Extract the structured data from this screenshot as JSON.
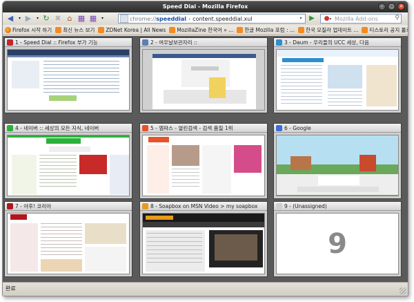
{
  "window": {
    "title": "Speed Dial - Mozilla Firefox"
  },
  "nav": {
    "url_scheme": "chrome://",
    "url_host": "speeddial",
    "url_separator": "›",
    "url_path": "content.speeddial.xul",
    "search_placeholder": "Mozilla Add-ons"
  },
  "bookmarks": [
    {
      "label": "Firefox 시작 하기",
      "icon": "firefox-icon"
    },
    {
      "label": "최신 뉴스 보기",
      "icon": "rss-icon"
    },
    {
      "label": "ZDNet Korea | All News",
      "icon": "rss-icon"
    },
    {
      "label": "MozillaZine 한국어 » ...",
      "icon": "rss-icon"
    },
    {
      "label": "한글 Mozilla 포럼 : ...",
      "icon": "rss-icon"
    },
    {
      "label": "한국 모질라 업데이트 ...",
      "icon": "rss-icon"
    },
    {
      "label": "티스토리 공지 블로그 ...",
      "icon": "rss-icon"
    }
  ],
  "bookmarks_more": "»",
  "dials": [
    {
      "label": "1 - Speed Dial :: Firefox 부가 기능",
      "favicon_color": "#c0282d"
    },
    {
      "label": "2 - 여우날보관자리 ::",
      "favicon_color": "#5a7fb8"
    },
    {
      "label": "3 - Daum - 우리들의 UCC 세상, 다음",
      "favicon_color": "#2d8ed0"
    },
    {
      "label": "4 - 네이버 :: 세상의 모든 지식, 네이버",
      "favicon_color": "#2bb03a"
    },
    {
      "label": "5 - 엠파스 - 열린검색 - 검색 품질 1위",
      "favicon_color": "#e8532b"
    },
    {
      "label": "6 - Google",
      "favicon_color": "#3a6fd8"
    },
    {
      "label": "7 - 야후! 코리아",
      "favicon_color": "#b0171d"
    },
    {
      "label": "8 - Soapbox on MSN Video > my soapbox",
      "favicon_color": "#e89a1c"
    },
    {
      "label": "9 - (Unassigned)",
      "favicon_color": "#cfcfcf"
    }
  ],
  "unassigned_number": "9",
  "status": {
    "text": "완료"
  }
}
